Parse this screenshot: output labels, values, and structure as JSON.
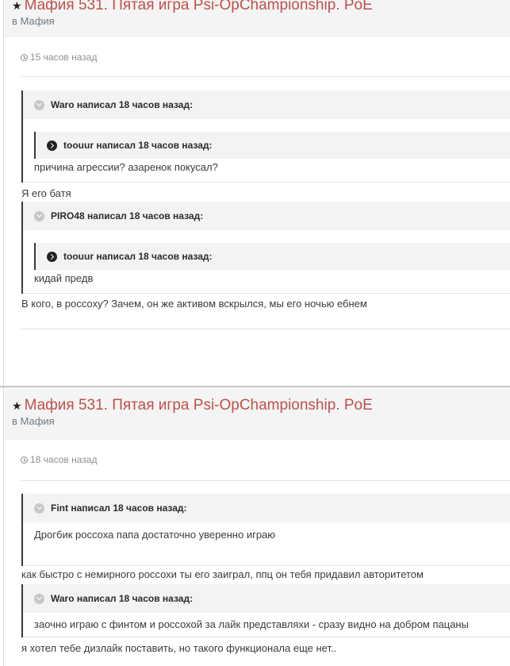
{
  "posts": [
    {
      "title": "Мафия 531. Пятая игра Psi-OpChampionship. PoE",
      "category": "в Мафия",
      "time": "15 часов назад",
      "quote1": {
        "header": "Waro написал 18 часов назад:",
        "inner": {
          "header": "toouur написал 18 часов назад:",
          "body": "причина агрессии? азаренок покусал?"
        }
      },
      "reply1": "Я его батя",
      "quote2": {
        "header": "PIRO48 написал 18 часов назад:",
        "inner": {
          "header": "toouur написал 18 часов назад:",
          "body": "кидай предв"
        }
      },
      "reply2": "В кого, в россоху? Зачем, он же активом вскрылся, мы его ночью ебнем"
    },
    {
      "title": "Мафия 531. Пятая игра Psi-OpChampionship. PoE",
      "category": "в Мафия",
      "time": "18 часов назад",
      "quote1": {
        "header": "Fint написал 18 часов назад:",
        "body": "Дрогбик россоха папа достаточно уверенно играю"
      },
      "reply1": "как быстро с немирного россохи ты его заиграл, ппц он тебя придавил авторитетом",
      "quote2": {
        "header": "Waro написал 18 часов назад:",
        "body": "заочно играю с финтом и россохой за лайк представляхи - сразу видно на добром пацаны"
      },
      "reply2": "я хотел тебе дизлайк поставить, но такого функционала еще нет.."
    }
  ]
}
